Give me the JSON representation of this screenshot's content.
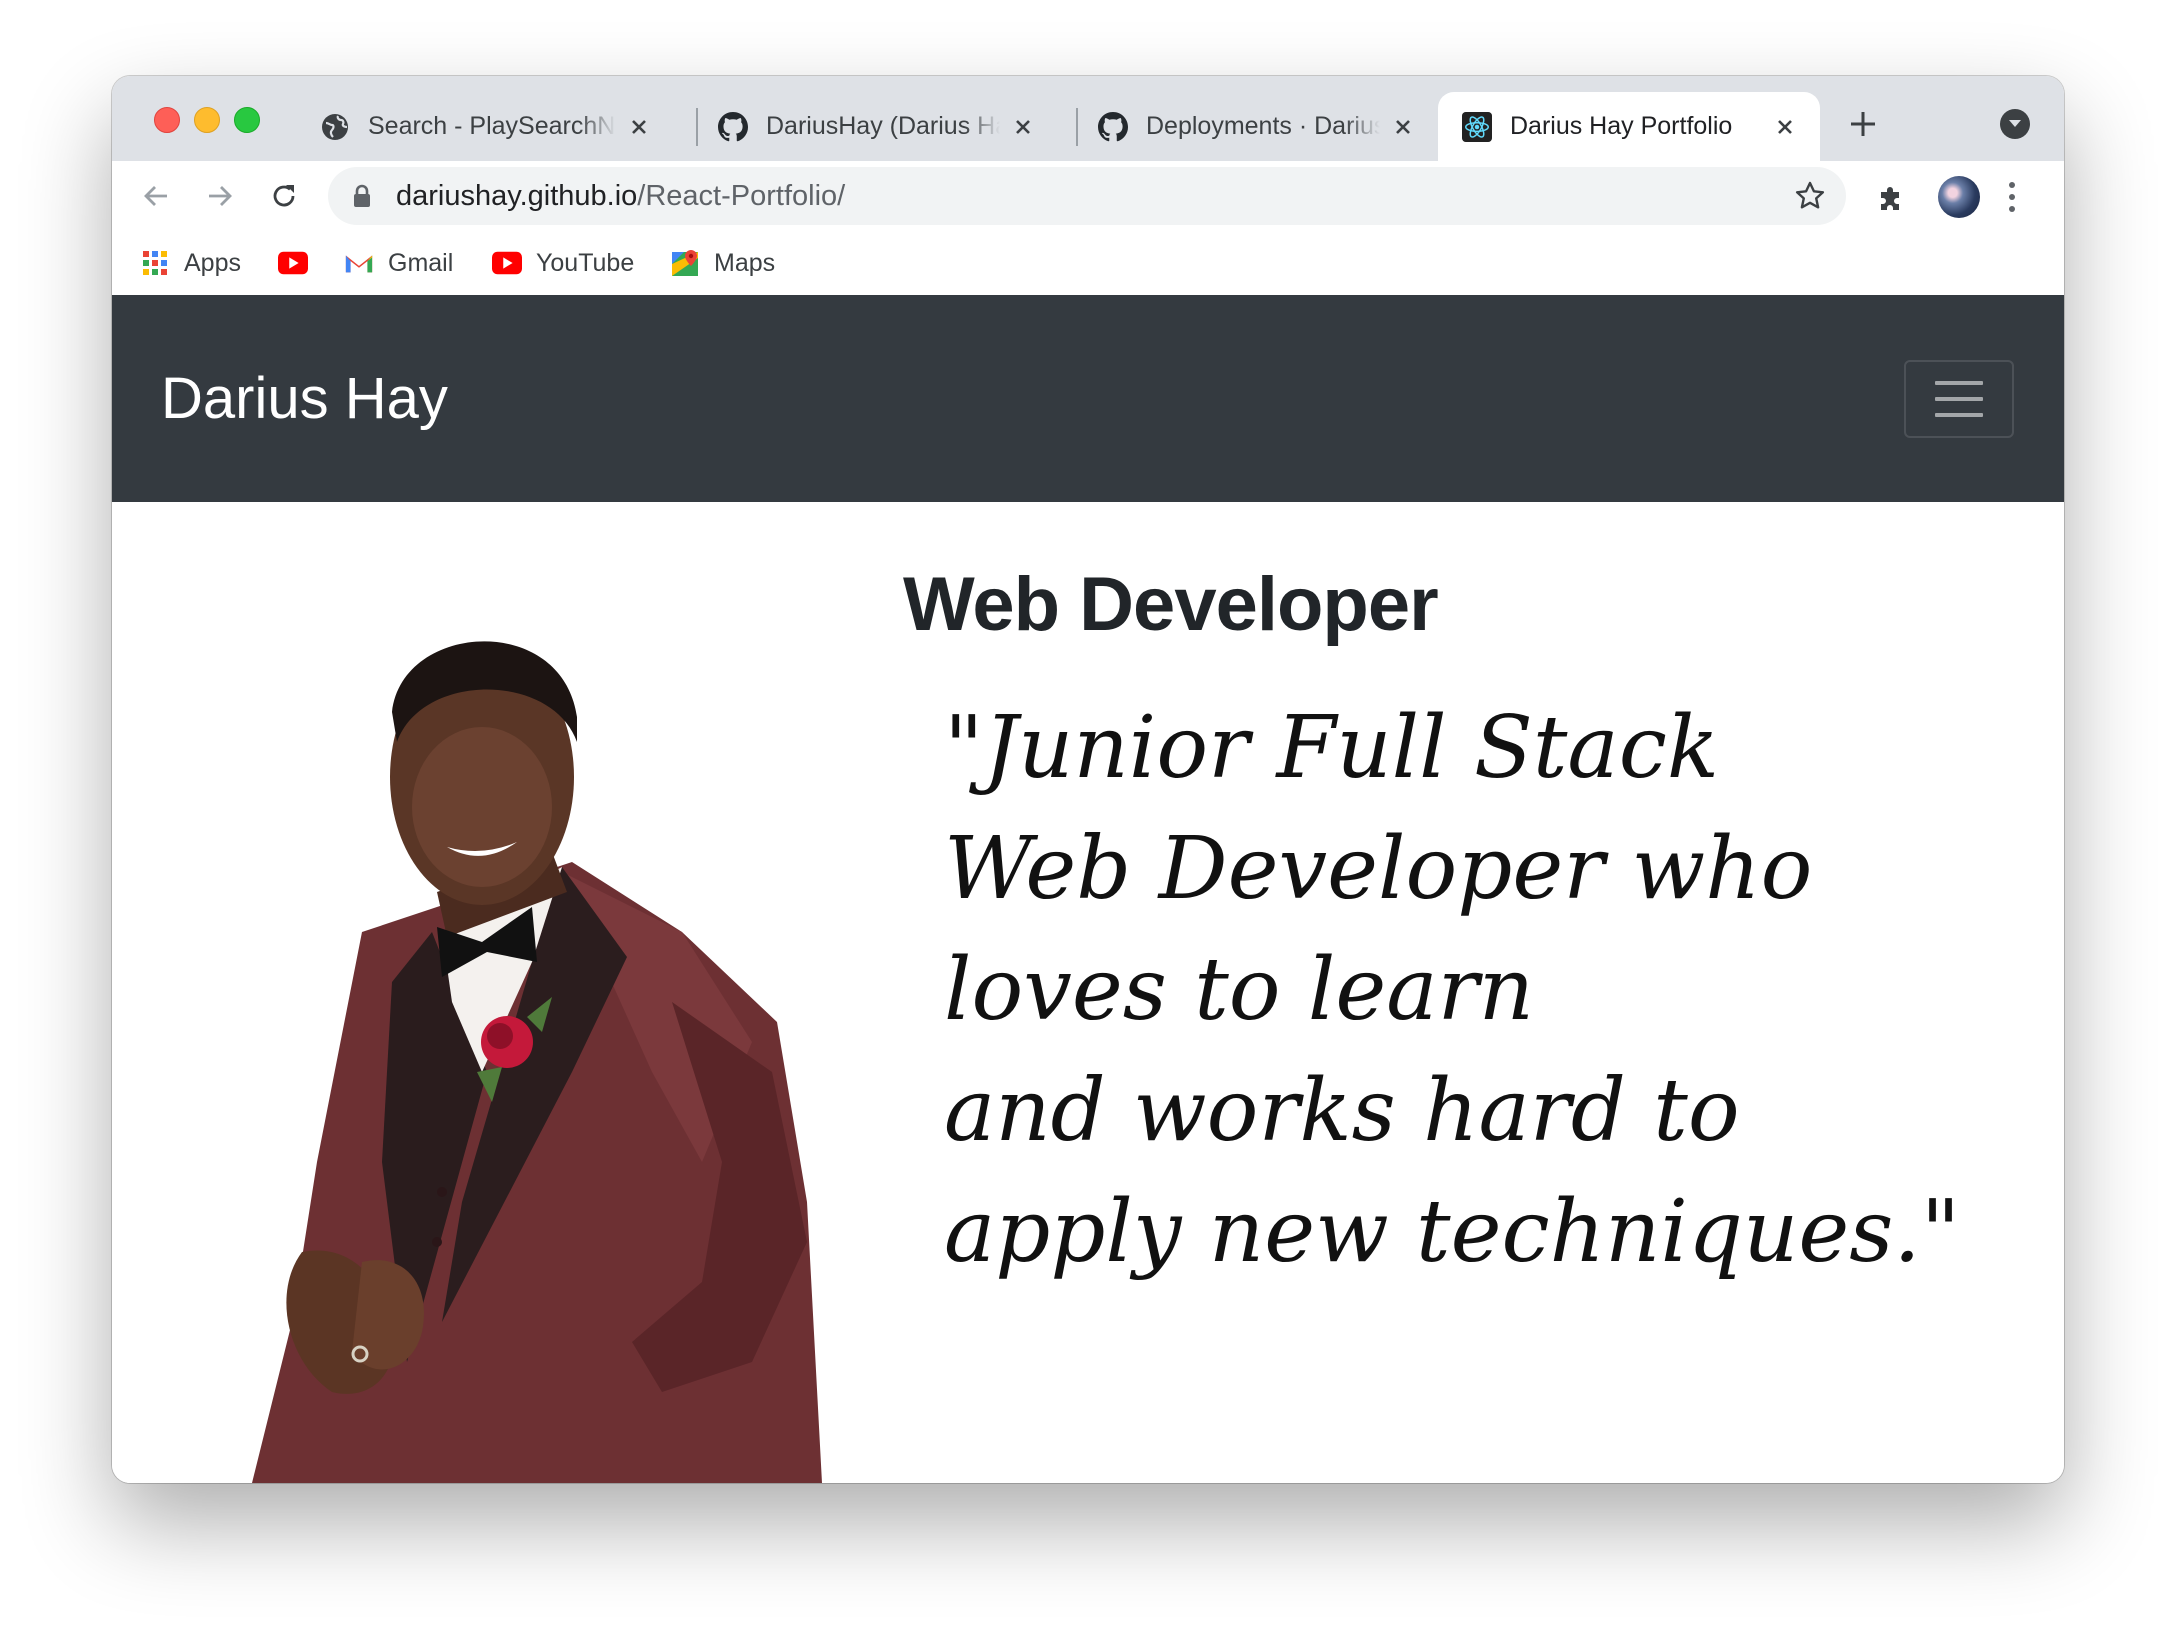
{
  "browser": {
    "tabs": [
      {
        "title": "Search - PlaySearchN",
        "icon": "globe-icon",
        "active": false
      },
      {
        "title": "DariusHay (Darius Hay",
        "icon": "github-icon",
        "active": false
      },
      {
        "title": "Deployments · DariusH",
        "icon": "github-icon",
        "active": false
      },
      {
        "title": "Darius Hay Portfolio",
        "icon": "react-icon",
        "active": true
      }
    ],
    "address": {
      "domain": "dariushay.github.io",
      "path": "/React-Portfolio/"
    },
    "bookmarks": [
      {
        "label": "Apps",
        "icon": "apps-grid-icon"
      },
      {
        "label": "",
        "icon": "youtube-icon"
      },
      {
        "label": "Gmail",
        "icon": "gmail-icon"
      },
      {
        "label": "YouTube",
        "icon": "youtube-icon"
      },
      {
        "label": "Maps",
        "icon": "maps-icon"
      }
    ]
  },
  "site": {
    "brand": "Darius Hay",
    "nav_bg": "#343a40",
    "heading": "Web Developer",
    "quote_lines": [
      "\"Junior Full Stack",
      "Web Developer who",
      "loves to learn",
      "and works hard to",
      "apply new techniques.\""
    ]
  }
}
